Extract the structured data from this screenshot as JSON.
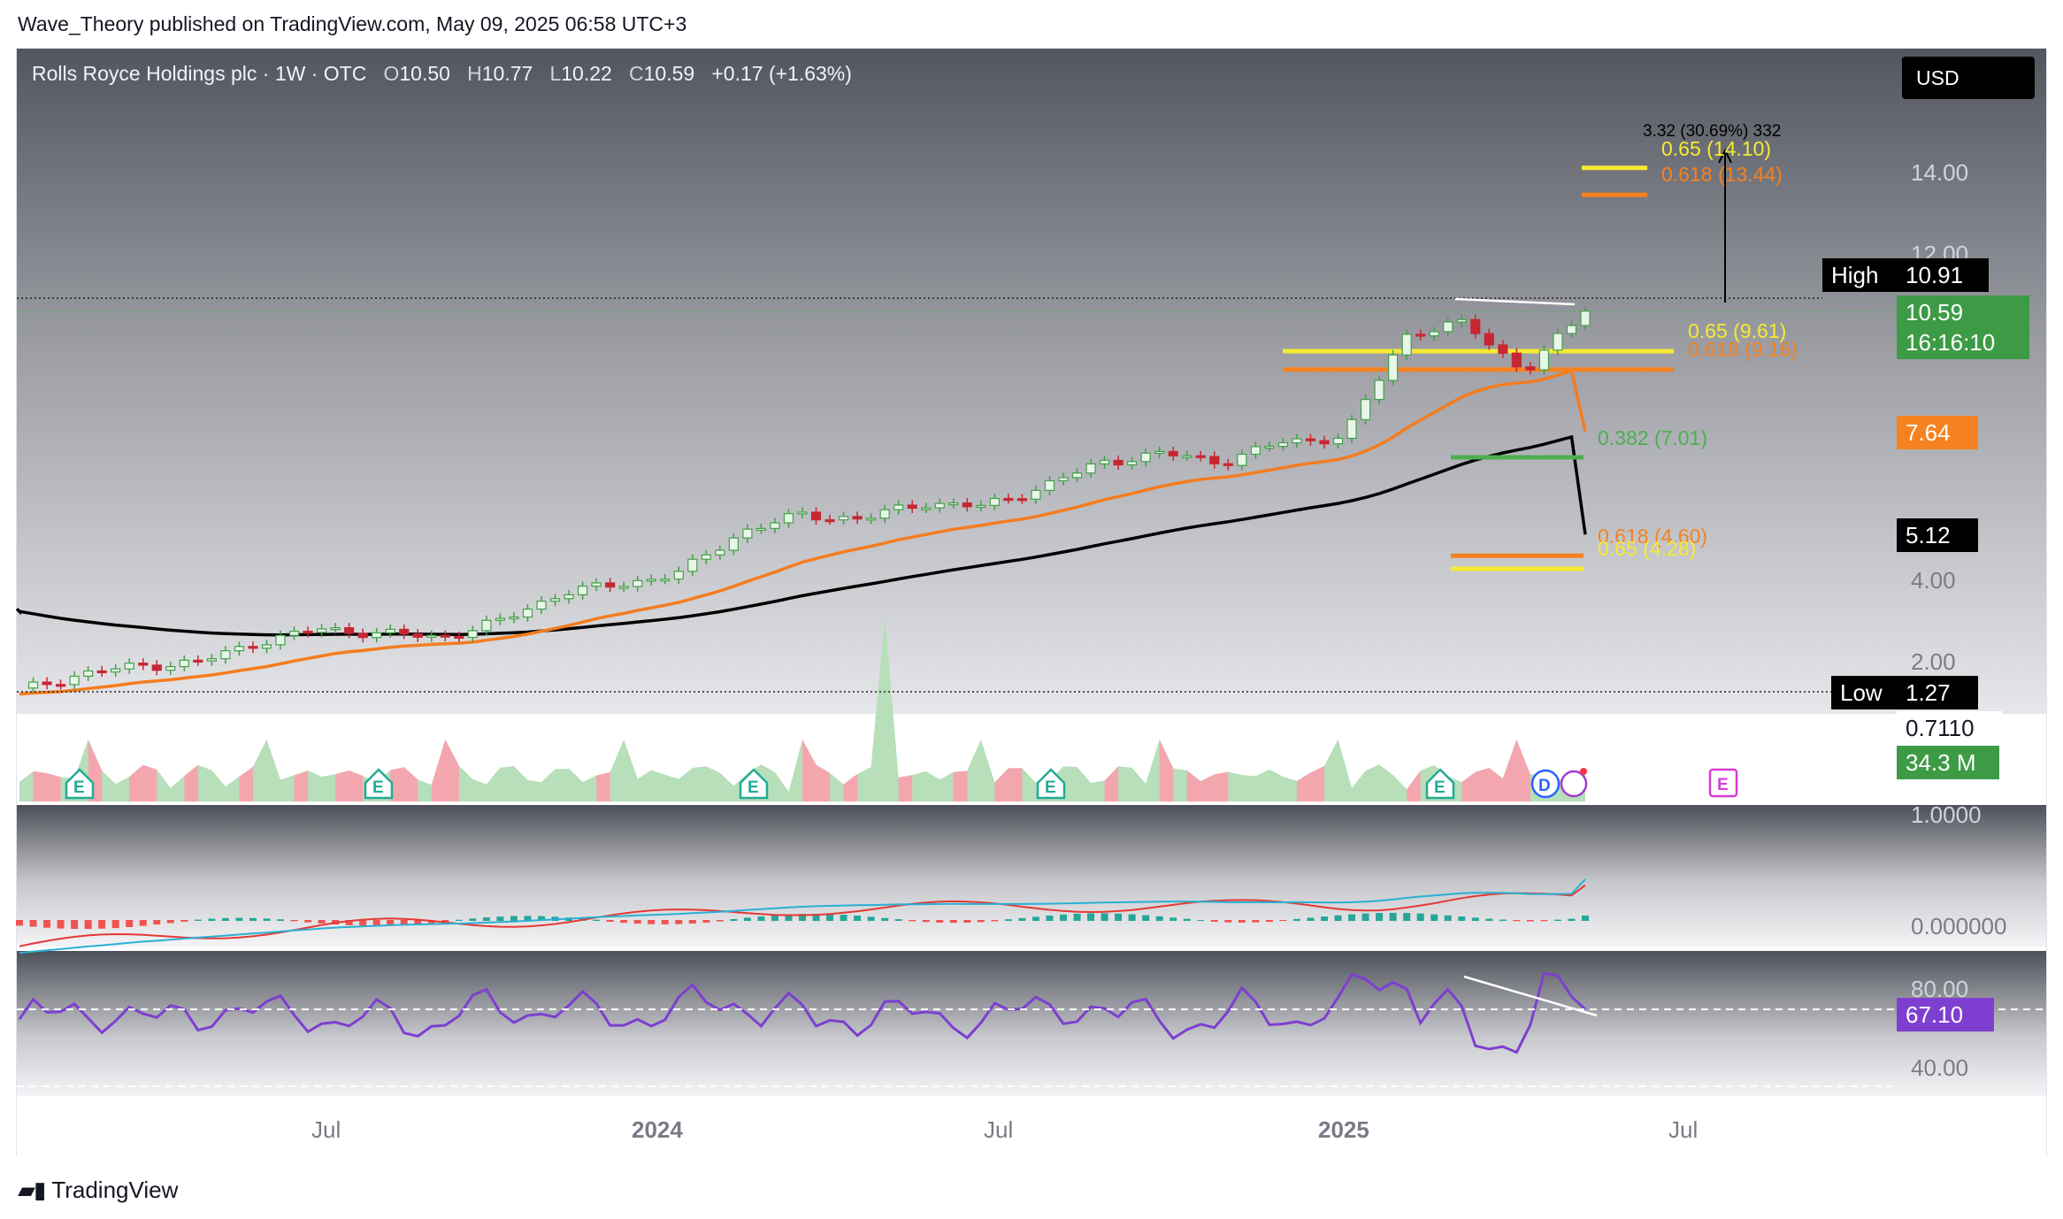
{
  "header": {
    "caption": "Wave_Theory published on TradingView.com, May 09, 2025 06:58 UTC+3"
  },
  "legend": {
    "symbol": "Rolls Royce Holdings plc · 1W · OTC",
    "o_label": "O",
    "o_value": "10.50",
    "h_label": "H",
    "h_value": "10.77",
    "l_label": "L",
    "l_value": "10.22",
    "c_label": "C",
    "c_value": "10.59",
    "change": "+0.17 (+1.63%)"
  },
  "currency": "USD",
  "footer": {
    "brand": "TradingView",
    "brand_icon": "tradingview-logo-icon"
  },
  "colors": {
    "up": "#43a047",
    "down": "#c62833",
    "ema50": "#f57c1f",
    "ema200": "#000000",
    "fib_yellow": "#f6ea32",
    "fib_orange": "#f5821f",
    "fib_green": "#4caf50",
    "macd": "#2ab0d3",
    "signal": "#e53935",
    "rsi": "#7e3fd0"
  },
  "price_axis": {
    "labels": [
      "14.00",
      "12.00",
      "4.00",
      "2.00"
    ],
    "high_label": "High",
    "high_value": "10.91",
    "low_label": "Low",
    "low_value": "1.27",
    "last_price": "10.59",
    "countdown": "16:16:10",
    "ema50_value": "7.64",
    "ema200_value": "5.12"
  },
  "volume_axis": {
    "value_label": "0.7110",
    "volume_value": "34.3 M"
  },
  "macd_axis": {
    "top": "1.0000",
    "bottom": "0.000000"
  },
  "rsi_axis": {
    "upper": "80.00",
    "lower": "40.00",
    "value": "67.10"
  },
  "time_axis": [
    "Jul",
    "2024",
    "Jul",
    "2025",
    "Jul"
  ],
  "fib_labels": {
    "t065": "0.65 (14.10)",
    "t0618": "0.618 (13.44)",
    "target": "3.32 (30.69%) 332",
    "m065": "0.65 (9.61)",
    "m0618": "0.618 (9.16)",
    "m0382": "0.382 (7.01)",
    "l0618": "0.618 (4.60)",
    "l065": "0.65 (4.28)"
  },
  "events": {
    "earnings": "E",
    "dividend": "D"
  },
  "chart_data": {
    "type": "line",
    "title": "Rolls Royce Holdings plc · 1W · OTC",
    "xlabel": "",
    "ylabel": "",
    "ylim": [
      0.7,
      15.5
    ],
    "x_range": [
      "2023-03",
      "2025-11"
    ],
    "close_series": [
      {
        "date": "2023-03",
        "close": 1.3
      },
      {
        "date": "2023-04",
        "close": 1.7
      },
      {
        "date": "2023-05",
        "close": 1.9
      },
      {
        "date": "2023-06",
        "close": 2.0
      },
      {
        "date": "2023-07",
        "close": 2.5
      },
      {
        "date": "2023-08",
        "close": 2.8
      },
      {
        "date": "2023-09",
        "close": 2.7
      },
      {
        "date": "2023-10",
        "close": 2.6
      },
      {
        "date": "2023-11",
        "close": 3.0
      },
      {
        "date": "2023-12",
        "close": 3.7
      },
      {
        "date": "2024-01",
        "close": 3.9
      },
      {
        "date": "2024-02",
        "close": 4.2
      },
      {
        "date": "2024-03",
        "close": 5.2
      },
      {
        "date": "2024-04",
        "close": 5.6
      },
      {
        "date": "2024-05",
        "close": 5.5
      },
      {
        "date": "2024-06",
        "close": 5.9
      },
      {
        "date": "2024-07",
        "close": 5.8
      },
      {
        "date": "2024-08",
        "close": 6.3
      },
      {
        "date": "2024-09",
        "close": 6.9
      },
      {
        "date": "2024-10",
        "close": 7.1
      },
      {
        "date": "2024-11",
        "close": 6.9
      },
      {
        "date": "2024-12",
        "close": 7.4
      },
      {
        "date": "2025-01",
        "close": 7.5
      },
      {
        "date": "2025-02",
        "close": 10.0
      },
      {
        "date": "2025-03",
        "close": 10.3
      },
      {
        "date": "2025-04",
        "close": 9.1
      },
      {
        "date": "2025-05",
        "close": 10.59
      }
    ],
    "fib_levels": [
      {
        "name": "0.65",
        "value": 14.1
      },
      {
        "name": "0.618",
        "value": 13.44
      },
      {
        "name": "0.65",
        "value": 9.61
      },
      {
        "name": "0.618",
        "value": 9.16
      },
      {
        "name": "0.382",
        "value": 7.01
      },
      {
        "name": "0.618",
        "value": 4.6
      },
      {
        "name": "0.65",
        "value": 4.28
      }
    ],
    "ema50_last": 7.64,
    "ema200_last": 5.12,
    "high": 10.91,
    "low": 1.27,
    "rsi_last": 67.1
  }
}
